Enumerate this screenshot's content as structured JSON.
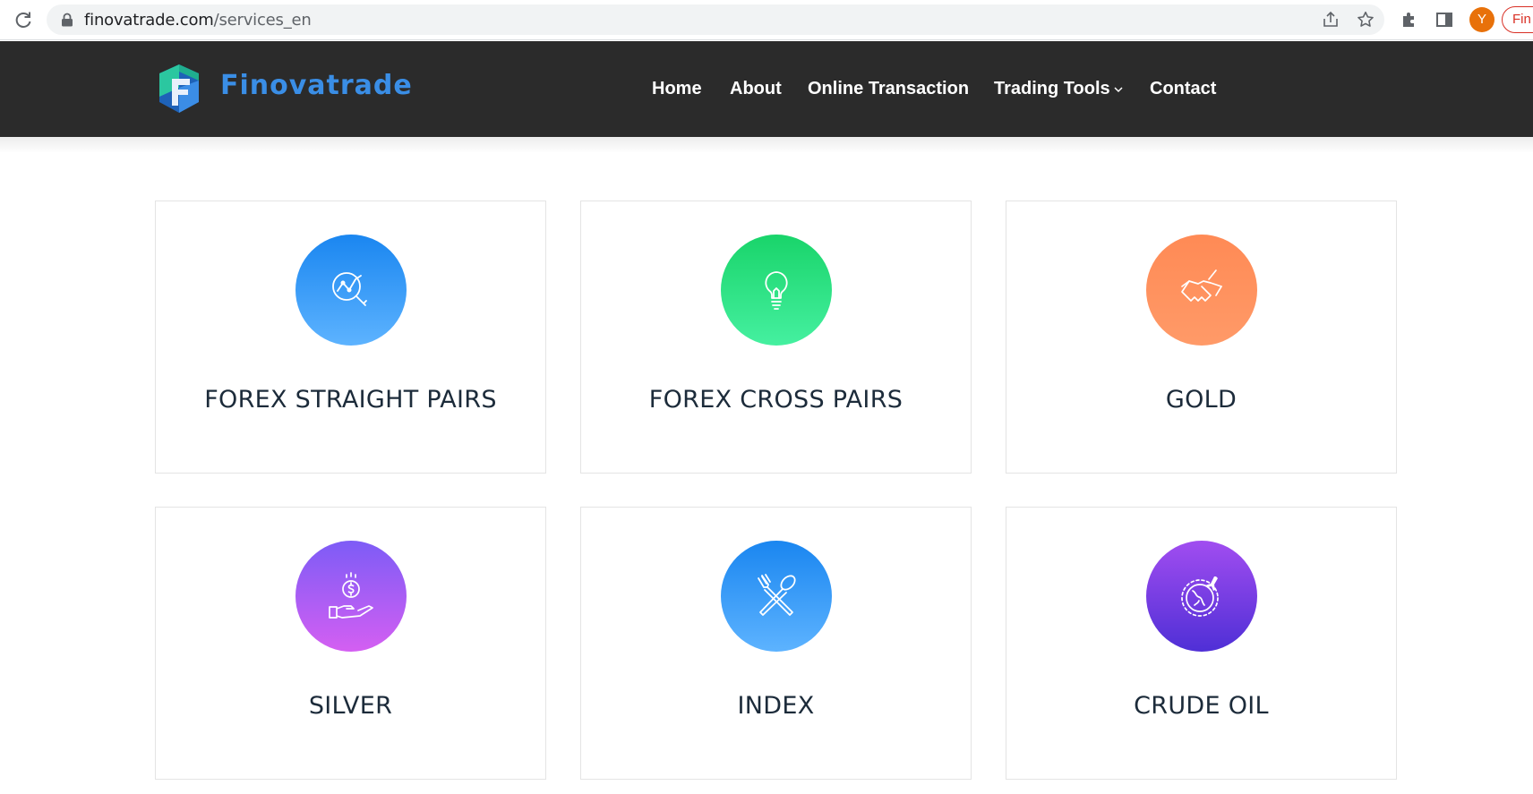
{
  "browser": {
    "url_domain": "finovatrade.com",
    "url_path": "/services_en",
    "avatar_letter": "Y",
    "tab_pill_text": "Fin"
  },
  "header": {
    "brand": "Finovatrade",
    "nav": [
      {
        "label": "Home"
      },
      {
        "label": "About"
      },
      {
        "label": "Online Transaction"
      },
      {
        "label": "Trading Tools",
        "has_dropdown": true
      },
      {
        "label": "Contact"
      }
    ]
  },
  "services": [
    {
      "title": "FOREX STRAIGHT PAIRS",
      "icon": "chart-magnifier-icon",
      "color": "#1a86f0"
    },
    {
      "title": "FOREX CROSS PAIRS",
      "icon": "lightbulb-icon",
      "color": "#19d46a"
    },
    {
      "title": "GOLD",
      "icon": "handshake-icon",
      "color": "#ff8a55"
    },
    {
      "title": "SILVER",
      "icon": "hand-coin-icon",
      "color": "#a15ff4"
    },
    {
      "title": "INDEX",
      "icon": "fork-spoon-icon",
      "color": "#1a86f0"
    },
    {
      "title": "CRUDE OIL",
      "icon": "globe-plane-icon",
      "color": "#7a3ee6"
    }
  ]
}
